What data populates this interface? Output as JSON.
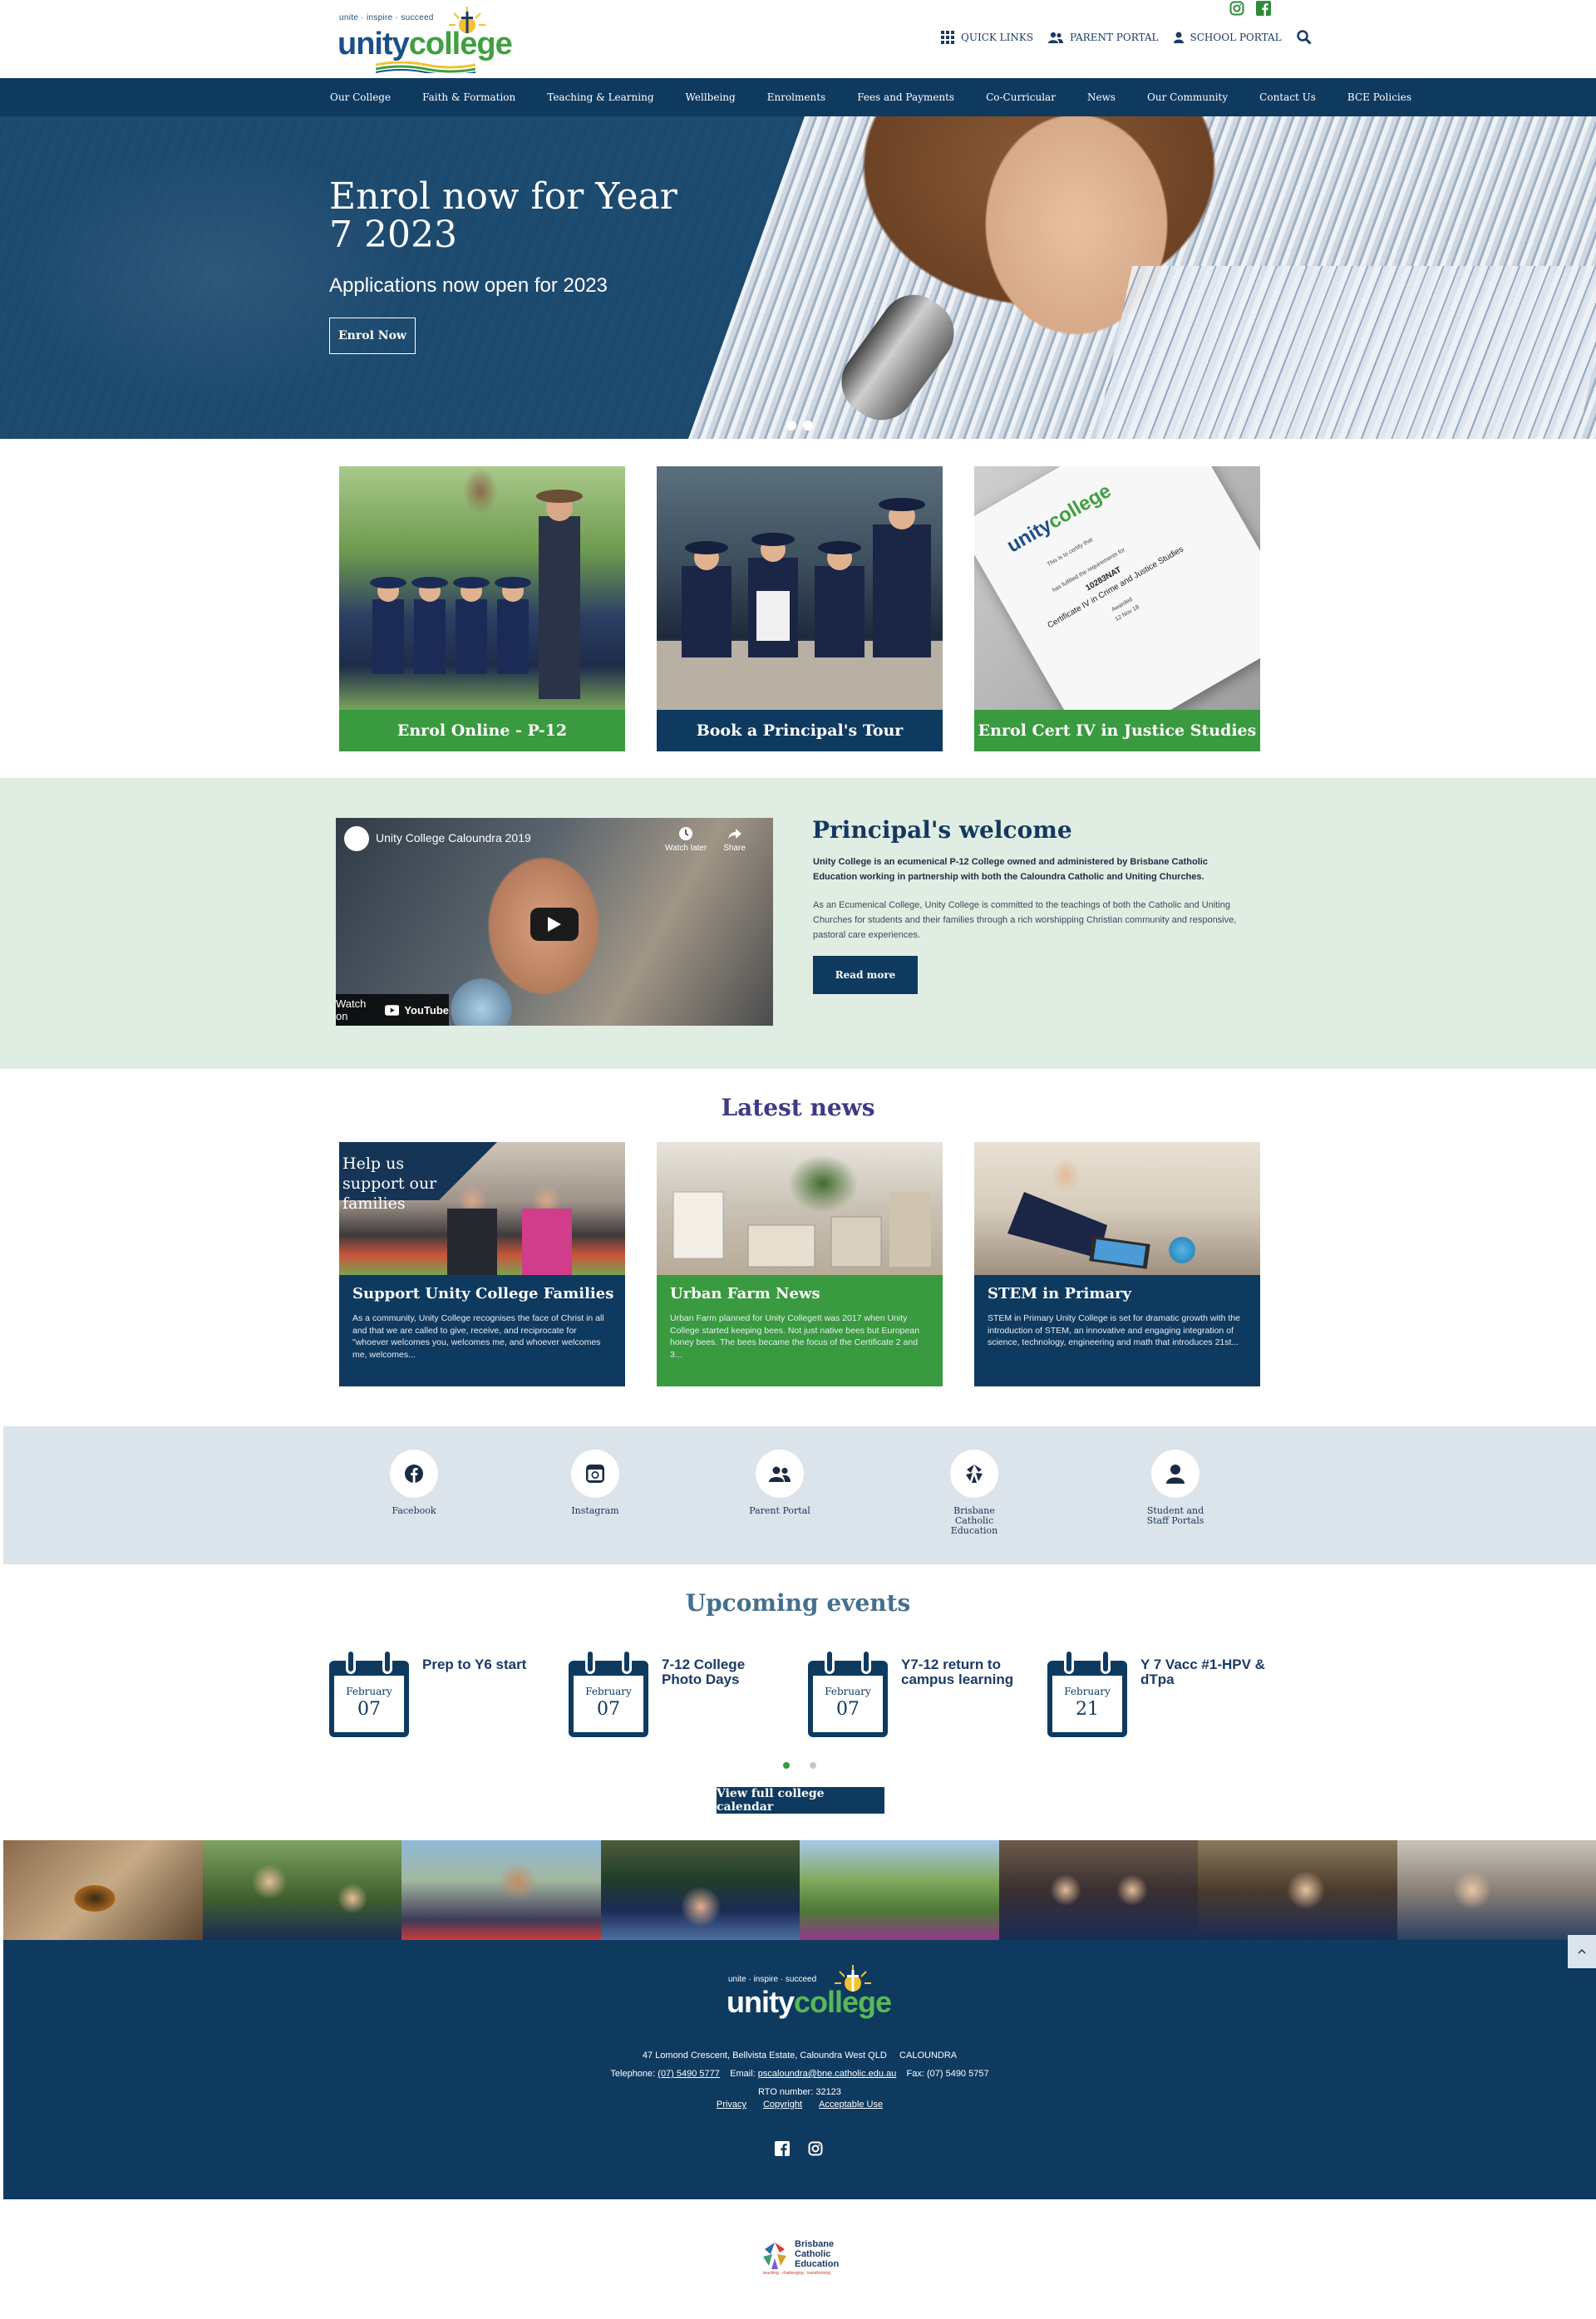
{
  "header": {
    "logo_tagline": "unite · inspire · succeed",
    "logo_word_1": "unity",
    "logo_word_2": "college",
    "top_links": [
      {
        "label": "QUICK LINKS",
        "icon": "grid-icon"
      },
      {
        "label": "PARENT PORTAL",
        "icon": "users-icon"
      },
      {
        "label": "SCHOOL PORTAL",
        "icon": "user-icon"
      }
    ],
    "social_icons": [
      "instagram-icon",
      "facebook-icon"
    ],
    "search_icon": "search-icon"
  },
  "nav": {
    "items": [
      "Our College",
      "Faith & Formation",
      "Teaching & Learning",
      "Wellbeing",
      "Enrolments",
      "Fees and Payments",
      "Co-Curricular",
      "News",
      "Our Community",
      "Contact Us",
      "BCE Policies"
    ]
  },
  "hero": {
    "title": "Enrol now for Year 7 2023",
    "subtitle": "Applications now open for 2023",
    "button": "Enrol Now",
    "slides": 2
  },
  "tiles": [
    {
      "label": "Enrol Online - P-12",
      "color": "#3a9a3f"
    },
    {
      "label": "Book a Principal's Tour",
      "color": "#0f3a60"
    },
    {
      "label": "Enrol Cert IV in Justice Studies",
      "color": "#3a9a3f"
    }
  ],
  "certificate": {
    "line1": "This is to certify that",
    "line2": "has fulfilled the requirements for",
    "code": "10283NAT",
    "course": "Certificate IV in Crime and Justice Studies",
    "awarded": "Awarded",
    "date": "12 Nov 18"
  },
  "principal": {
    "video_title": "Unity College Caloundra 2019",
    "watch_label": "Watch on",
    "youtube_label": "YouTube",
    "watch_later": "Watch later",
    "share": "Share",
    "title": "Principal's welcome",
    "lead": "Unity College is an ecumenical P-12 College owned and administered by Brisbane Catholic Education working in partnership with both the Caloundra Catholic and Uniting Churches.",
    "body": "As an Ecumenical College, Unity College is committed to the teachings of both the Catholic and Uniting Churches for students and their families through a rich worshipping Christian community and responsive, pastoral care experiences.",
    "button": "Read more"
  },
  "news": {
    "title": "Latest news",
    "items": [
      {
        "overlay": "Help us support our families",
        "title": "Support Unity College Families",
        "text": "As a community, Unity College recognises the face of Christ in all and that we are called to give, receive, and reciprocate for \"whoever welcomes you, welcomes me, and whoever welcomes me, welcomes...",
        "color": "#0f3a60"
      },
      {
        "overlay": "",
        "title": "Urban Farm News",
        "text": "Urban Farm planned for Unity CollegeIt was 2017 when Unity College started keeping bees. Not just native bees but European honey bees. The bees became the focus of the Certificate 2 and 3...",
        "color": "#3a9a3f"
      },
      {
        "overlay": "",
        "title": "STEM in Primary",
        "text": "STEM in Primary Unity College is set for dramatic growth with the introduction of STEM, an innovative and engaging integration of science, technology, engineering and math that introduces 21st...",
        "color": "#0f3a60"
      }
    ]
  },
  "quick_links": [
    {
      "label": "Facebook",
      "icon": "facebook-icon"
    },
    {
      "label": "Instagram",
      "icon": "instagram-icon"
    },
    {
      "label": "Parent Portal",
      "icon": "users-icon"
    },
    {
      "label": "Brisbane Catholic Education",
      "icon": "bce-icon"
    },
    {
      "label": "Student and Staff Portals",
      "icon": "user-icon"
    }
  ],
  "events": {
    "title": "Upcoming events",
    "items": [
      {
        "month": "February",
        "day": "07",
        "title": "Prep to Y6 start"
      },
      {
        "month": "February",
        "day": "07",
        "title": "7-12 College Photo Days"
      },
      {
        "month": "February",
        "day": "07",
        "title": "Y7-12 return to campus learning"
      },
      {
        "month": "February",
        "day": "21",
        "title": "Y 7 Vacc #1-HPV & dTpa"
      }
    ],
    "pages": 2,
    "button": "View full college calendar"
  },
  "footer": {
    "tagline": "unite · inspire · succeed",
    "logo_word_1": "unity",
    "logo_word_2": "college",
    "address": "47 Lomond Crescent, Bellvista Estate, Caloundra West QLD",
    "suburb": "CALOUNDRA",
    "telephone_label": "Telephone:",
    "telephone": "(07) 5490 5777",
    "email_label": "Email:",
    "email": "pscaloundra@bne.catholic.edu.au",
    "fax": "Fax: (07) 5490 5757",
    "rto": "RTO number: 32123",
    "links": [
      "Privacy",
      "Copyright",
      "Acceptable Use"
    ],
    "social_icons": [
      "facebook-icon",
      "instagram-icon"
    ]
  },
  "bce_logo": {
    "line1": "Brisbane",
    "line2": "Catholic",
    "line3": "Education",
    "tagline": "teaching · challenging · transforming"
  }
}
